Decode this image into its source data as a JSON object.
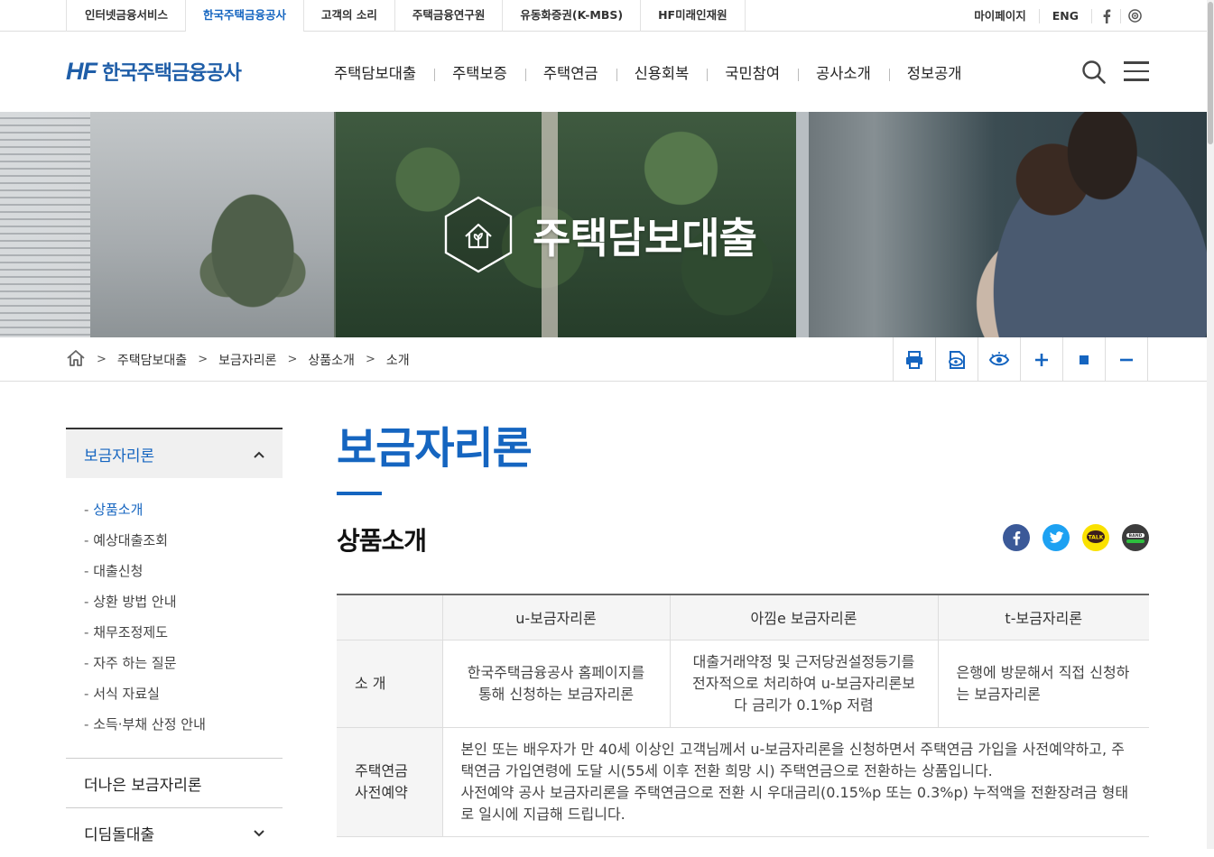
{
  "topbar": {
    "sites": [
      {
        "label": "인터넷금융서비스"
      },
      {
        "label": "한국주택금융공사"
      },
      {
        "label": "고객의 소리"
      },
      {
        "label": "주택금융연구원"
      },
      {
        "label": "유동화증권(K-MBS)"
      },
      {
        "label": "HF미래인재원"
      }
    ],
    "active_site": "한국주택금융공사",
    "util": {
      "mypage": "마이페이지",
      "eng": "ENG",
      "icons": [
        "facebook-icon",
        "instagram-icon"
      ]
    }
  },
  "header": {
    "logo_mark": "HF",
    "logo_name": "한국주택금융공사",
    "nav": [
      {
        "label": "주택담보대출"
      },
      {
        "label": "주택보증"
      },
      {
        "label": "주택연금"
      },
      {
        "label": "신용회복"
      },
      {
        "label": "국민참여"
      },
      {
        "label": "공사소개"
      },
      {
        "label": "정보공개"
      }
    ]
  },
  "hero": {
    "title": "주택담보대출",
    "icon": "house-plant-icon"
  },
  "breadcrumb": {
    "items": [
      {
        "label": "주택담보대출"
      },
      {
        "label": "보금자리론"
      },
      {
        "label": "상품소개"
      },
      {
        "label": "소개"
      }
    ],
    "tools": [
      "print-icon",
      "view-icon",
      "eye-icon",
      "zoom-in-icon",
      "reset-icon",
      "zoom-out-icon"
    ]
  },
  "sidebar": {
    "head": "보금자리론",
    "items": [
      {
        "label": "상품소개",
        "active": true
      },
      {
        "label": "예상대출조회"
      },
      {
        "label": "대출신청"
      },
      {
        "label": "상환 방법 안내"
      },
      {
        "label": "채무조정제도"
      },
      {
        "label": "자주 하는 질문"
      },
      {
        "label": "서식 자료실"
      },
      {
        "label": "소득·부채 산정 안내"
      }
    ],
    "groups": [
      {
        "label": "더나은 보금자리론"
      },
      {
        "label": "디딤돌대출"
      }
    ]
  },
  "content": {
    "title": "보금자리론",
    "subtitle": "상품소개",
    "share": [
      "facebook-icon",
      "twitter-icon",
      "kakaotalk-icon",
      "band-icon"
    ],
    "share_text": {
      "talk": "TALK",
      "band": "BAND"
    },
    "table": {
      "headers": [
        "u-보금자리론",
        "아낌e 보금자리론",
        "t-보금자리론"
      ],
      "rows": [
        {
          "label": "소 개",
          "cells": [
            "한국주택금융공사 홈페이지를 통해 신청하는 보금자리론",
            "대출거래약정 및 근저당권설정등기를 전자적으로 처리하여 u-보금자리론보다 금리가 0.1%p 저렴",
            "은행에 방문해서 직접 신청하는 보금자리론"
          ]
        },
        {
          "label": "주택연금 사전예약",
          "text1": "본인 또는 배우자가 만 40세 이상인 고객님께서 u-보금자리론을 신청하면서 주택연금 가입을 사전예약하고, 주택연금 가입연령에 도달 시(55세 이후 전환 희망 시) 주택연금으로 전환하는 상품입니다.",
          "text2": "사전예약 공사 보금자리론을 주택연금으로 전환 시 우대금리(0.15%p 또는 0.3%p) 누적액을 전환장려금 형태로 일시에 지급해 드립니다."
        }
      ]
    }
  },
  "colors": {
    "brand": "#1565c0",
    "logo": "#1f5ea8",
    "logo_accent": "#e89020",
    "facebook": "#3b5998",
    "twitter": "#1da1f2",
    "kakao": "#fae100",
    "band": "#3c3c3c"
  }
}
